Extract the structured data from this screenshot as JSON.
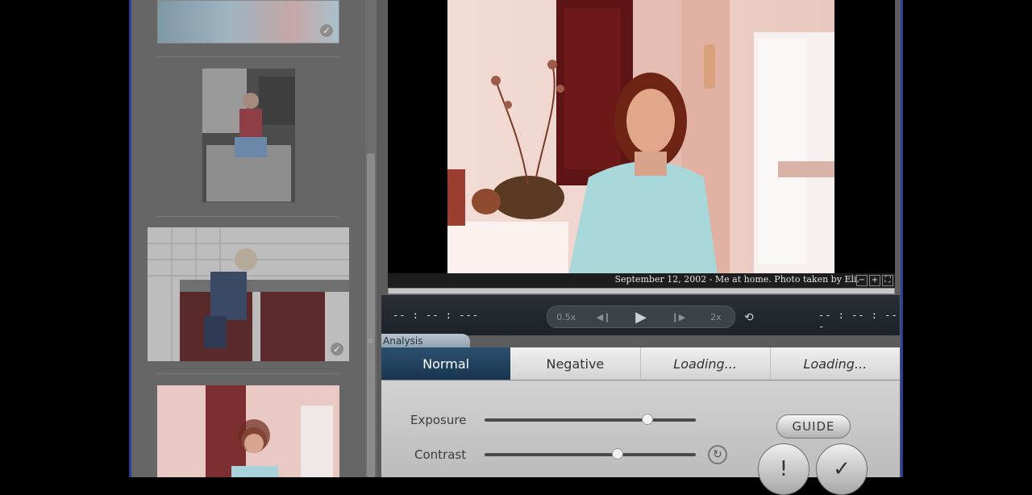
{
  "viewer": {
    "caption": "September 12, 2002 - Me at home. Photo taken by Eli.",
    "zoom_buttons": [
      "−",
      "+",
      "⛶"
    ]
  },
  "transport": {
    "time_left": "-- : -- : ---",
    "time_right": "-- : -- : ---",
    "speed_slow": "0.5x",
    "speed_fast": "2x",
    "prev_icon": "step-back-icon",
    "play_icon": "play-icon",
    "next_icon": "step-forward-icon",
    "loop_icon": "loop-icon"
  },
  "analysis": {
    "tab_label": "Analysis",
    "modes": [
      "Normal",
      "Negative",
      "Loading...",
      "Loading..."
    ],
    "active_mode": "Normal",
    "exposure_label": "Exposure",
    "contrast_label": "Contrast",
    "exposure_level": 0.77,
    "contrast_level": 0.63,
    "guide_label": "GUIDE"
  },
  "thumbnails": [
    {
      "checked": true
    },
    {
      "checked": true
    },
    {
      "checked": true
    },
    {
      "checked": false
    }
  ],
  "colors": {
    "frame_border": "#2a3f9c",
    "active_mode": "#1f4060"
  }
}
